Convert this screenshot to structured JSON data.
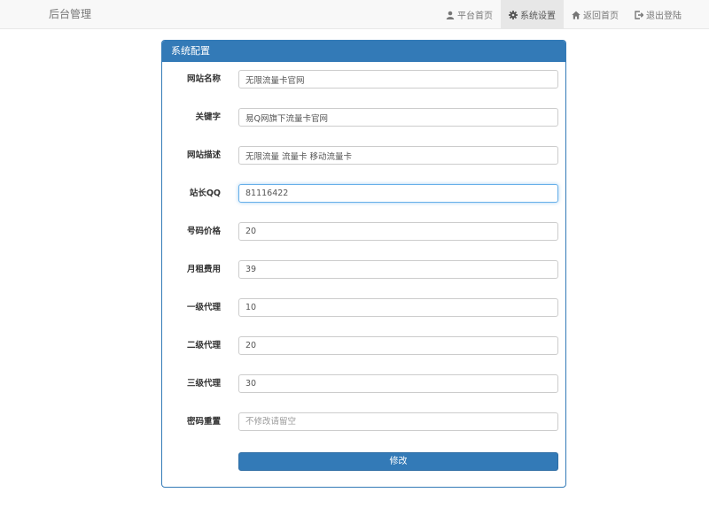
{
  "navbar": {
    "brand": "后台管理",
    "items": [
      {
        "label": "平台首页",
        "icon": "user-icon",
        "active": false
      },
      {
        "label": "系统设置",
        "icon": "gear-icon",
        "active": true
      },
      {
        "label": "返回首页",
        "icon": "home-icon",
        "active": false
      },
      {
        "label": "退出登陆",
        "icon": "logout-icon",
        "active": false
      }
    ]
  },
  "panel": {
    "title": "系统配置",
    "fields": [
      {
        "label": "网站名称",
        "value": "无限流量卡官网",
        "placeholder": ""
      },
      {
        "label": "关键字",
        "value": "易Q网旗下流量卡官网",
        "placeholder": ""
      },
      {
        "label": "网站描述",
        "value": "无限流量 流量卡 移动流量卡",
        "placeholder": ""
      },
      {
        "label": "站长QQ",
        "value": "81116422",
        "placeholder": ""
      },
      {
        "label": "号码价格",
        "value": "20",
        "placeholder": ""
      },
      {
        "label": "月租费用",
        "value": "39",
        "placeholder": ""
      },
      {
        "label": "一级代理",
        "value": "10",
        "placeholder": ""
      },
      {
        "label": "二级代理",
        "value": "20",
        "placeholder": ""
      },
      {
        "label": "三级代理",
        "value": "30",
        "placeholder": ""
      },
      {
        "label": "密码重置",
        "value": "",
        "placeholder": "不修改请留空"
      }
    ],
    "submit_label": "修改"
  },
  "colors": {
    "primary": "#337ab7",
    "navbar_bg": "#f8f8f8",
    "nav_text": "#777777",
    "focus_border": "#66afe9"
  }
}
